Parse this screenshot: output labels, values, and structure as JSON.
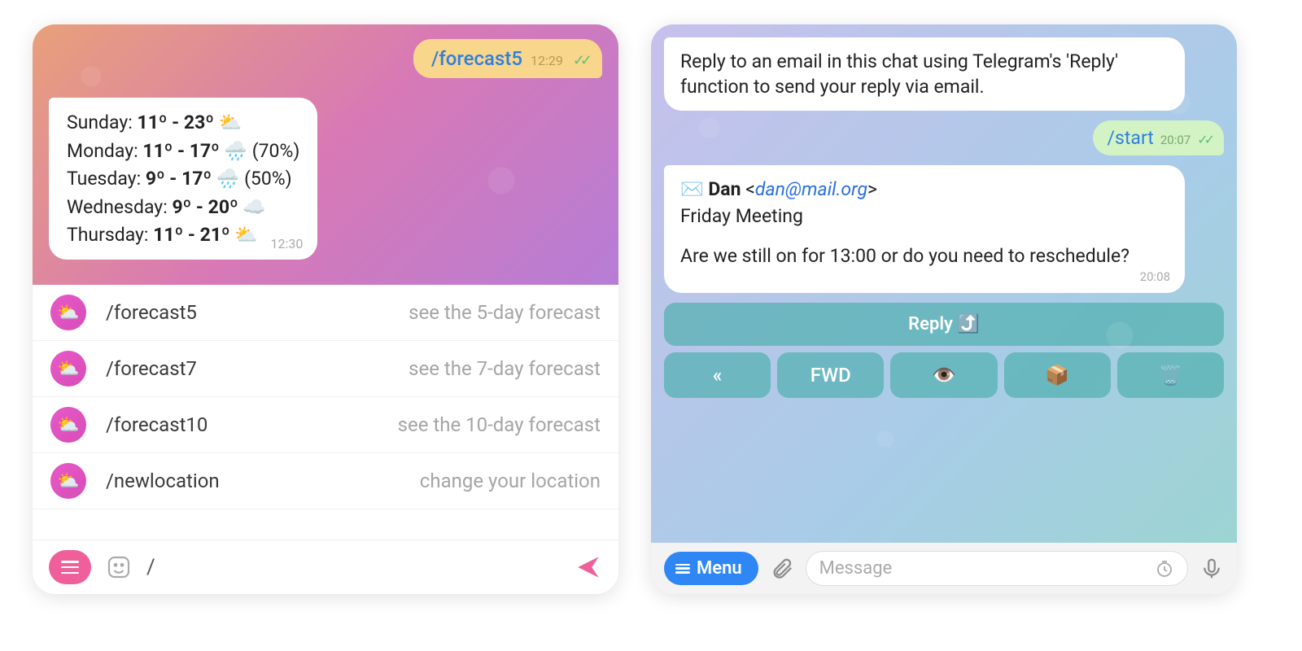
{
  "left": {
    "outgoing": {
      "command": "/forecast5",
      "time": "12:29"
    },
    "forecast": {
      "lines": [
        {
          "day": "Sunday:",
          "range": "11º - 23º",
          "icon": "⛅",
          "extra": ""
        },
        {
          "day": "Monday:",
          "range": "11º - 17º",
          "icon": "🌧️",
          "extra": "(70%)"
        },
        {
          "day": "Tuesday:",
          "range": "9º - 17º",
          "icon": "🌧️",
          "extra": "(50%)"
        },
        {
          "day": "Wednesday:",
          "range": "9º - 20º",
          "icon": "☁️",
          "extra": ""
        },
        {
          "day": "Thursday:",
          "range": "11º - 21º",
          "icon": "⛅",
          "extra": ""
        }
      ],
      "time": "12:30"
    },
    "suggestions": [
      {
        "cmd": "/forecast5",
        "desc": "see the 5-day forecast"
      },
      {
        "cmd": "/forecast7",
        "desc": "see the 7-day forecast"
      },
      {
        "cmd": "/forecast10",
        "desc": "see the 10-day forecast"
      },
      {
        "cmd": "/newlocation",
        "desc": "change your location"
      }
    ],
    "input": {
      "value": "/"
    }
  },
  "right": {
    "instructions": "Reply to an email in this chat using Telegram's 'Reply' function to send your reply via email.",
    "outgoing": {
      "command": "/start",
      "time": "20:07"
    },
    "email": {
      "envelope": "✉️",
      "from_name": "Dan",
      "from_addr": "dan@mail.org",
      "subject": "Friday Meeting",
      "body": "Are we still on for 13:00 or do you need to reschedule?",
      "time": "20:08"
    },
    "keyboard": {
      "reply": "Reply ⤴️",
      "row": [
        "«",
        "FWD",
        "👁️",
        "📦",
        "🗑️"
      ]
    },
    "menu_label": "Menu",
    "input_placeholder": "Message"
  }
}
